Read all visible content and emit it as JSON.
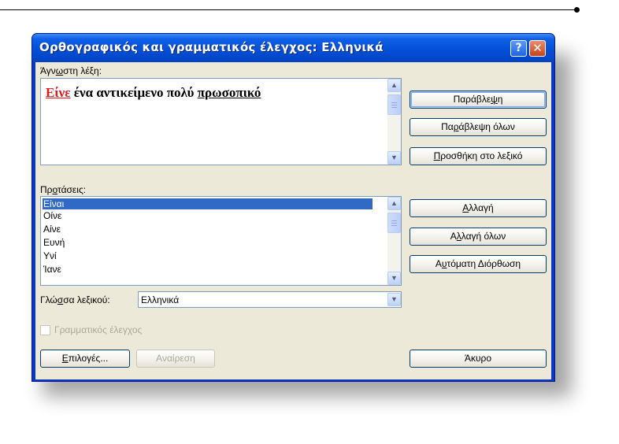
{
  "dialog": {
    "title": "Ορθογραφικός και γραμματικός έλεγχος: Ελληνικά",
    "help_glyph": "?",
    "close_glyph": "✕"
  },
  "unknown_word": {
    "label_pre": "Άγν",
    "label_key": "ω",
    "label_post": "στη λέξη:",
    "error_word": "Είνε",
    "middle_text": " ένα αντικείμενο πολύ ",
    "grammar_word": "πρωσοπικό"
  },
  "suggestions": {
    "label_pre": "Πρ",
    "label_key": "ο",
    "label_post": "τάσεις:",
    "items": [
      "Είναι",
      "Οίνε",
      "Αίνε",
      "Ευνή",
      "Υνί",
      "Ίανε"
    ],
    "selected_index": 0
  },
  "dictionary": {
    "label_pre": "Γλώ",
    "label_key": "σ",
    "label_post": "σα λεξικού:",
    "value": "Ελληνικά"
  },
  "grammar_check": {
    "label": "Γραμματικός έλεγχος",
    "checked": false,
    "enabled": false
  },
  "buttons": {
    "ignore": {
      "pre": "Παράβλε",
      "key": "ψ",
      "post": "η"
    },
    "ignore_all": {
      "pre": "Πα",
      "key": "ρ",
      "post": "άβλεψη όλων"
    },
    "add_dict": {
      "pre": "",
      "key": "Π",
      "post": "ροσθήκη στο λεξικό"
    },
    "change": {
      "pre": "",
      "key": "Α",
      "post": "λλαγή"
    },
    "change_all": {
      "pre": "Α",
      "key": "λ",
      "post": "λαγή όλων"
    },
    "autocorrect": {
      "pre": "Α",
      "key": "υ",
      "post": "τόματη Διόρθωση"
    },
    "options": {
      "pre": "",
      "key": "Ε",
      "post": "πιλογές..."
    },
    "undo": {
      "label": "Αναίρεση"
    },
    "cancel": {
      "label": "Άκυρο"
    }
  },
  "colors": {
    "title_bar": "#0450d8",
    "dialog_bg": "#ece9d8",
    "selection": "#316ac5",
    "error_underline": "#e01818"
  }
}
